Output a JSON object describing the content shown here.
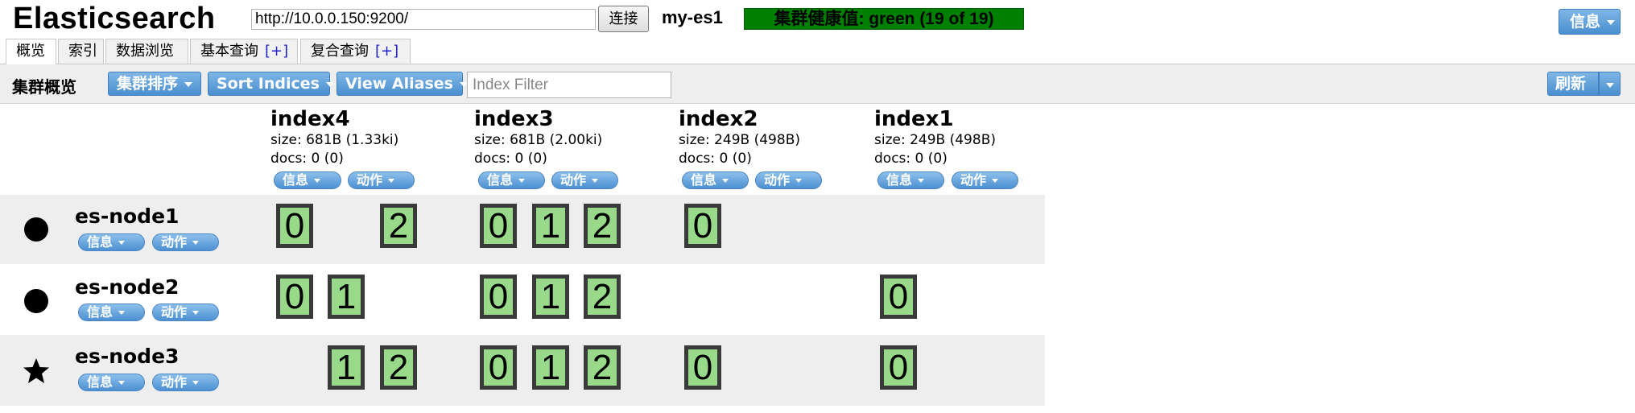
{
  "header": {
    "title": "Elasticsearch",
    "url": "http://10.0.0.150:9200/",
    "connect_label": "连接",
    "cluster_name": "my-es1",
    "health": "集群健康值: green (19 of 19)",
    "health_color": "#008000",
    "info_label": "信息"
  },
  "tabs": [
    {
      "label": "概览",
      "active": true
    },
    {
      "label": "索引"
    },
    {
      "label": "数据浏览"
    },
    {
      "label": "基本查询",
      "plus": "[+]"
    },
    {
      "label": "复合查询",
      "plus": "[+]"
    }
  ],
  "toolbar": {
    "title": "集群概览",
    "sort_cluster": "集群排序",
    "sort_indices": "Sort Indices",
    "view_aliases": "View Aliases",
    "filter_placeholder": "Index Filter",
    "refresh": "刷新"
  },
  "buttons": {
    "info": "信息",
    "action": "动作"
  },
  "indices": [
    {
      "name": "index4",
      "size": "size: 681B (1.33ki)",
      "docs": "docs: 0 (0)"
    },
    {
      "name": "index3",
      "size": "size: 681B (2.00ki)",
      "docs": "docs: 0 (0)"
    },
    {
      "name": "index2",
      "size": "size: 249B (498B)",
      "docs": "docs: 0 (0)"
    },
    {
      "name": "index1",
      "size": "size: 249B (498B)",
      "docs": "docs: 0 (0)"
    }
  ],
  "nodes": [
    {
      "name": "es-node1",
      "icon": "circle-icon",
      "shards": [
        [
          "0",
          "",
          "2"
        ],
        [
          "0",
          "1",
          "2"
        ],
        [
          "0"
        ],
        []
      ]
    },
    {
      "name": "es-node2",
      "icon": "circle-icon",
      "shards": [
        [
          "0",
          "1",
          ""
        ],
        [
          "0",
          "1",
          "2"
        ],
        [],
        [
          "0"
        ]
      ]
    },
    {
      "name": "es-node3",
      "icon": "star-icon",
      "shards": [
        [
          "",
          "1",
          "2"
        ],
        [
          "0",
          "1",
          "2"
        ],
        [
          "0"
        ],
        [
          "0"
        ]
      ]
    }
  ],
  "colors": {
    "shard_fill": "#98d98a",
    "shard_border": "#3a3a3a",
    "button_blue": "#4a8fd0"
  }
}
